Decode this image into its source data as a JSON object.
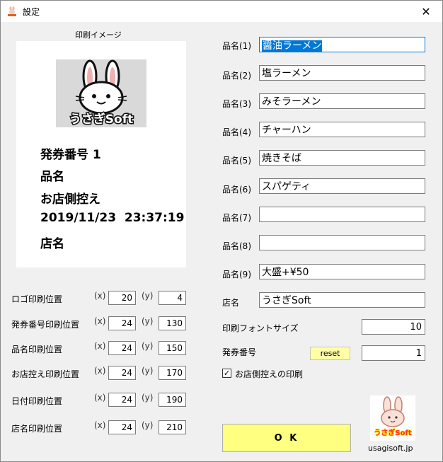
{
  "window": {
    "title": "設定",
    "close_glyph": "✕"
  },
  "preview": {
    "label": "印刷イメージ",
    "logo_text": "うさぎSoft",
    "lines": [
      "発券番号 1",
      "品名",
      "お店側控え",
      "2019/11/23  23:37:19",
      "店名"
    ]
  },
  "positions": {
    "x_label": "(x)",
    "y_label": "(y)",
    "rows": [
      {
        "label": "ロゴ印刷位置",
        "x": "20",
        "y": "4"
      },
      {
        "label": "発券番号印刷位置",
        "x": "24",
        "y": "130"
      },
      {
        "label": "品名印刷位置",
        "x": "24",
        "y": "150"
      },
      {
        "label": "お店控え印刷位置",
        "x": "24",
        "y": "170"
      },
      {
        "label": "日付印刷位置",
        "x": "24",
        "y": "190"
      },
      {
        "label": "店名印刷位置",
        "x": "24",
        "y": "210"
      }
    ]
  },
  "items": [
    {
      "label": "品名(1)",
      "value": "醤油ラーメン"
    },
    {
      "label": "品名(2)",
      "value": "塩ラーメン"
    },
    {
      "label": "品名(3)",
      "value": "みそラーメン"
    },
    {
      "label": "品名(4)",
      "value": "チャーハン"
    },
    {
      "label": "品名(5)",
      "value": "焼きそば"
    },
    {
      "label": "品名(6)",
      "value": "スパゲティ"
    },
    {
      "label": "品名(7)",
      "value": ""
    },
    {
      "label": "品名(8)",
      "value": ""
    },
    {
      "label": "品名(9)",
      "value": "大盛+¥50"
    }
  ],
  "shop": {
    "label": "店名",
    "value": "うさぎSoft"
  },
  "font_size": {
    "label": "印刷フォントサイズ",
    "value": "10"
  },
  "ticket": {
    "label": "発券番号",
    "reset_label": "reset",
    "value": "1"
  },
  "receipt_checkbox": {
    "label": "お店側控えの印刷",
    "checked": true,
    "check_glyph": "✓"
  },
  "ok_label": "O K",
  "footer": {
    "url": "usagisoft.jp",
    "logo_text": "うさぎSoft"
  }
}
